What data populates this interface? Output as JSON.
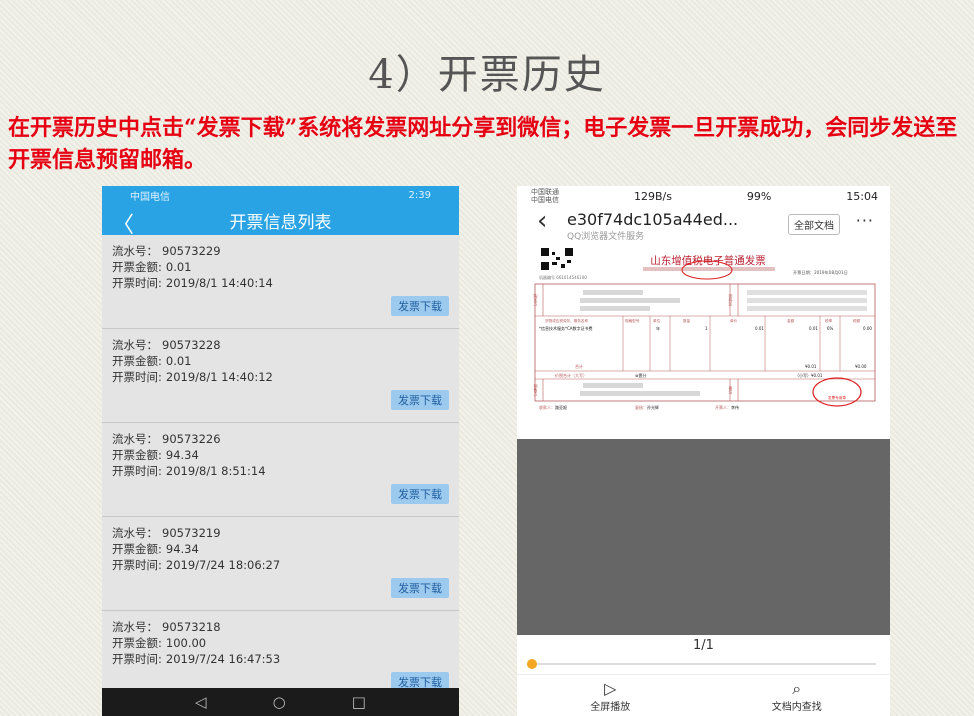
{
  "slide": {
    "title": "4）开票历史",
    "description": "在开票历史中点击“发票下载”系统将发票网址分享到微信；电子发票一旦开票成功，会同步发送至开票信息预留邮箱。"
  },
  "left_phone": {
    "status": {
      "carrier": "中国电信",
      "time": "2:39"
    },
    "header": {
      "back_icon": "chevron-left-icon",
      "title": "开票信息列表"
    },
    "labels": {
      "serial": "流水号：",
      "amount": "开票金额:",
      "time": "开票时间:"
    },
    "download_label": "发票下载",
    "records": [
      {
        "serial": "90573229",
        "amount": "0.01",
        "time": "2019/8/1 14:40:14"
      },
      {
        "serial": "90573228",
        "amount": "0.01",
        "time": "2019/8/1 14:40:12"
      },
      {
        "serial": "90573226",
        "amount": "94.34",
        "time": "2019/8/1 8:51:14"
      },
      {
        "serial": "90573219",
        "amount": "94.34",
        "time": "2019/7/24 18:06:27"
      },
      {
        "serial": "90573218",
        "amount": "100.00",
        "time": "2019/7/24 16:47:53"
      }
    ],
    "nav": {
      "back": "◁",
      "home": "○",
      "recent": "□"
    }
  },
  "right_phone": {
    "status": {
      "carrier_line1": "中国联通",
      "carrier_line2": "中国电信",
      "speed": "129B/s",
      "battery": "99%",
      "time": "15:04"
    },
    "header": {
      "title": "e30f74dc105a44ed...",
      "subtitle": "QQ浏览器文件服务",
      "all_docs_label": "全部文档",
      "more": "···"
    },
    "invoice": {
      "title": "山东增值税电子普通发票",
      "date_label": "开票日期：2019年08月01日",
      "item_name": "*信息技术服务*CA数字证书费",
      "unit": "年",
      "qty": "1",
      "price": "0.01",
      "amount": "0.01",
      "tax_rate": "6%",
      "tax": "0.00",
      "total_label": "价税合计（大写）",
      "total_words": "⊗壹分",
      "total_small": "（小写）¥0.01",
      "sum_amount": "¥0.01",
      "sum_tax": "¥0.00",
      "payee_label": "收款人：",
      "payee": "路亚妮",
      "reviewer_label": "复核：",
      "reviewer": "孙光辉",
      "issuer_label": "开票人：",
      "issuer": "李伟",
      "seller_stamp_label": "发票专用章",
      "sections": {
        "buyer": "购买方",
        "seller": "销售方",
        "password": "密码区",
        "remark": "备注"
      },
      "columns": [
        "货物或应税劳务、服务名称",
        "规格型号",
        "单位",
        "数量",
        "单价",
        "金额",
        "税率",
        "税额"
      ],
      "total_row_label": "合计"
    },
    "page_indicator": "1/1",
    "bottom": [
      {
        "icon": "play-icon",
        "label": "全屏播放"
      },
      {
        "icon": "search-icon",
        "label": "文档内查找"
      }
    ]
  },
  "colors": {
    "title_red": "#e60012",
    "header_blue": "#2aa3e5",
    "button_blue": "#9cc9ee",
    "invoice_line": "#b85a5a"
  }
}
